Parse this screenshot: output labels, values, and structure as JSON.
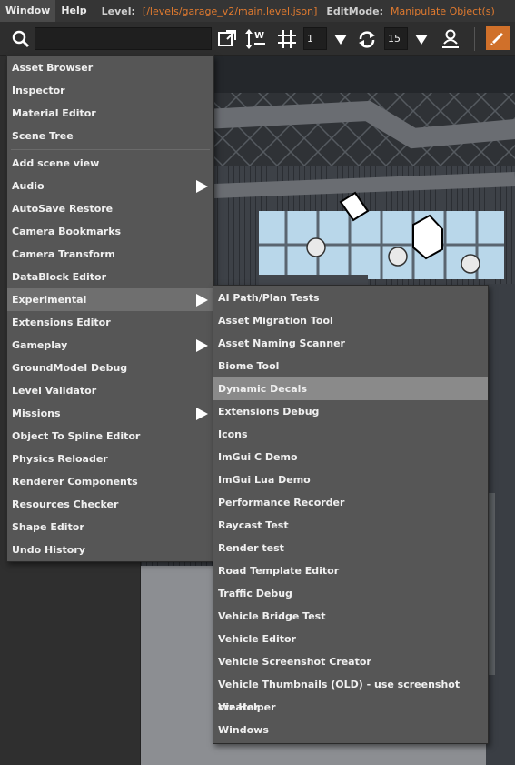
{
  "menubar": {
    "items": [
      "Window",
      "Help"
    ],
    "level_label": "Level:",
    "level_value": "[/levels/garage_v2/main.level.json]",
    "editmode_label": "EditMode:",
    "editmode_value": "Manipulate Object(s)"
  },
  "toolbar": {
    "search_value": "",
    "snap_value": "1",
    "rotate_snap_value": "15",
    "icons": [
      "search-icon",
      "fit-view-icon",
      "axis-local-icon",
      "grid-snap-icon",
      "dropdown-icon",
      "rotate-snap-icon",
      "dropdown-icon",
      "user-pin-icon",
      "pencil-icon"
    ],
    "accent_color": "#d0702a"
  },
  "window_menu": {
    "group1": [
      "Asset Browser",
      "Inspector",
      "Material Editor",
      "Scene Tree"
    ],
    "group2": [
      {
        "label": "Add scene view",
        "submenu": false
      },
      {
        "label": "Audio",
        "submenu": true
      },
      {
        "label": "AutoSave Restore",
        "submenu": false
      },
      {
        "label": "Camera Bookmarks",
        "submenu": false
      },
      {
        "label": "Camera Transform",
        "submenu": false
      },
      {
        "label": "DataBlock Editor",
        "submenu": false
      },
      {
        "label": "Experimental",
        "submenu": true
      },
      {
        "label": "Extensions Editor",
        "submenu": false
      },
      {
        "label": "Gameplay",
        "submenu": true
      },
      {
        "label": "GroundModel Debug",
        "submenu": false
      },
      {
        "label": "Level Validator",
        "submenu": false
      },
      {
        "label": "Missions",
        "submenu": true
      },
      {
        "label": "Object To Spline Editor",
        "submenu": false
      },
      {
        "label": "Physics Reloader",
        "submenu": false
      },
      {
        "label": "Renderer Components",
        "submenu": false
      },
      {
        "label": "Resources Checker",
        "submenu": false
      },
      {
        "label": "Shape Editor",
        "submenu": false
      },
      {
        "label": "Undo History",
        "submenu": false
      }
    ],
    "highlighted": "Experimental"
  },
  "experimental_menu": {
    "items": [
      "AI Path/Plan Tests",
      "Asset Migration Tool",
      "Asset Naming Scanner",
      "Biome Tool",
      "Dynamic Decals",
      "Extensions Debug",
      "Icons",
      "ImGui C Demo",
      "ImGui Lua Demo",
      "Performance Recorder",
      "Raycast Test",
      "Render test",
      "Road Template Editor",
      "Traffic Debug",
      "Vehicle Bridge Test",
      "Vehicle Editor",
      "Vehicle Screenshot Creator",
      "Vehicle Thumbnails (OLD) - use screenshot creator",
      "Viz Helper",
      "Windows"
    ],
    "selected": "Dynamic Decals"
  }
}
